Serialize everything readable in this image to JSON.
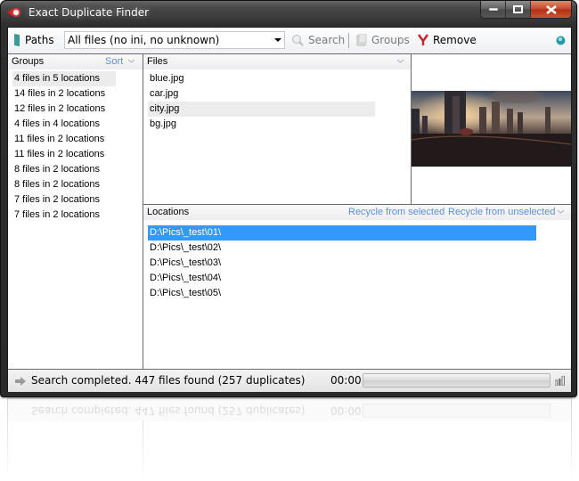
{
  "window": {
    "title": "Exact Duplicate Finder"
  },
  "toolbar": {
    "paths_label": "Paths",
    "filter_value": "All files (no ini, no unknown)",
    "search_label": "Search",
    "groups_label": "Groups",
    "remove_label": "Remove"
  },
  "groups": {
    "header": "Groups",
    "sort_label": "Sort",
    "items": [
      "4 files in 5 locations",
      "14 files in 2 locations",
      "12 files in 2 locations",
      "4 files in 4 locations",
      "11 files in 2 locations",
      "11 files in 2 locations",
      "8 files in 2 locations",
      "8 files in 2 locations",
      "7 files in 2 locations",
      "7 files in 2 locations"
    ],
    "selected_index": 0
  },
  "files": {
    "header": "Files",
    "items": [
      "blue.jpg",
      "car.jpg",
      "city.jpg",
      "bg.jpg"
    ],
    "selected_index": 2
  },
  "preview": {
    "description": "futuristic city skyline at sunset"
  },
  "locations": {
    "header": "Locations",
    "recycle_selected_label": "Recycle from selected",
    "recycle_unselected_label": "Recycle from unselected",
    "items": [
      "D:\\Pics\\_test\\01\\",
      "D:\\Pics\\_test\\02\\",
      "D:\\Pics\\_test\\03\\",
      "D:\\Pics\\_test\\04\\",
      "D:\\Pics\\_test\\05\\"
    ],
    "selected_index": 0
  },
  "status": {
    "message": "Search completed. 447 files found (257 duplicates)",
    "elapsed": "00:00",
    "progress_percent": 0
  },
  "colors": {
    "selection_blue": "#3399ff",
    "link_blue": "#5b8fd8",
    "remove_red": "#d0202a",
    "close_red": "#c4472b"
  }
}
